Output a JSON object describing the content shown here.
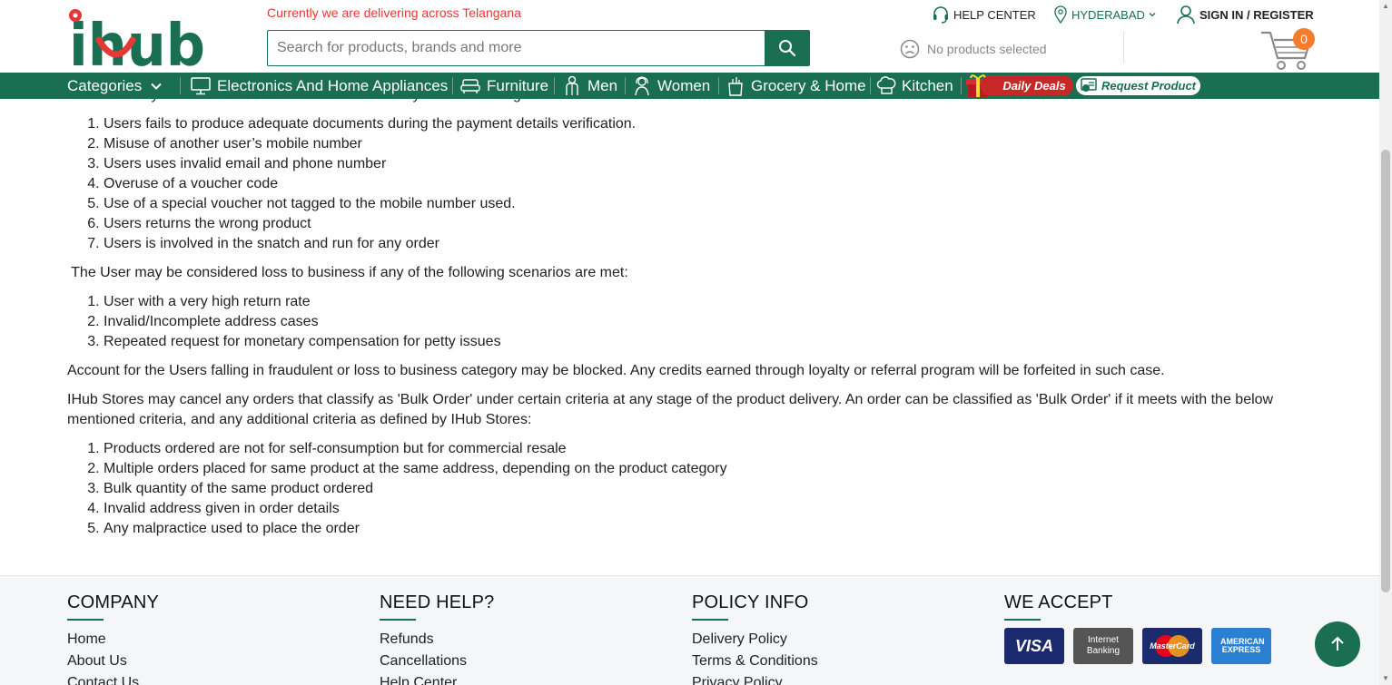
{
  "header": {
    "delivery_notice": "Currently we are delivering across Telangana",
    "search_placeholder": "Search for products, brands and more",
    "help_center": "HELP CENTER",
    "city": "HYDERABAD",
    "sign_in": "SIGN IN / REGISTER",
    "compare_text": "No products selected",
    "cart_count": "0",
    "logo_text": "ihub"
  },
  "nav": {
    "categories": "Categories",
    "items": [
      "Electronics And Home Appliances",
      "Furniture",
      "Men",
      "Women",
      "Grocery & Home",
      "Kitchen"
    ],
    "daily_deals": "Daily Deals",
    "request_product": "Request Product"
  },
  "content": {
    "cut_paragraph": "The User may be considered fraudulent if inter alia any of the following scenarios are met:",
    "fraud_list": [
      "Users fails to produce adequate documents during the payment details verification.",
      "Misuse of another user’s mobile number",
      "Users uses invalid email and phone number",
      "Overuse of a voucher code",
      "Use of a special voucher not tagged to the mobile number used.",
      "Users returns the wrong product",
      "Users is involved in the snatch and run for any order"
    ],
    "loss_intro": " The User may be considered loss to business if any of the following scenarios are met:",
    "loss_list": [
      "User with a very high return rate",
      "Invalid/Incomplete address cases",
      "Repeated request for monetary compensation for petty issues"
    ],
    "blocked_para": "Account for the Users falling in fraudulent or loss to business category may be blocked. Any credits earned through loyalty or referral program will be forfeited in such case.",
    "bulk_para": "IHub Stores may cancel any orders that classify as 'Bulk Order' under certain criteria at any stage of the product delivery. An order can be classified as 'Bulk Order' if it meets with the below mentioned criteria, and any additional criteria as defined by IHub Stores:",
    "bulk_list": [
      "Products ordered are not for self-consumption but for commercial resale",
      "Multiple orders placed for same product at the same address, depending on the product category",
      "Bulk quantity of the same product ordered",
      "Invalid address given in order details",
      "Any malpractice used to place the order"
    ]
  },
  "footer": {
    "company": {
      "title": "COMPANY",
      "links": [
        "Home",
        "About Us",
        "Contact Us"
      ]
    },
    "help": {
      "title": "NEED HELP?",
      "links": [
        "Refunds",
        "Cancellations",
        "Help Center"
      ]
    },
    "policy": {
      "title": "POLICY INFO",
      "links": [
        "Delivery Policy",
        "Terms & Conditions",
        "Privacy Policy"
      ]
    },
    "accept": {
      "title": "WE ACCEPT"
    },
    "cards": {
      "visa": "VISA",
      "netbanking": "Internet Banking",
      "mastercard": "MasterCard",
      "amex": "AMERICAN EXPRESS"
    }
  },
  "colors": {
    "brand_green": "#1a6f52",
    "alert_red": "#e53935",
    "cart_badge": "#f57c2a",
    "deals_red": "#c62828"
  }
}
